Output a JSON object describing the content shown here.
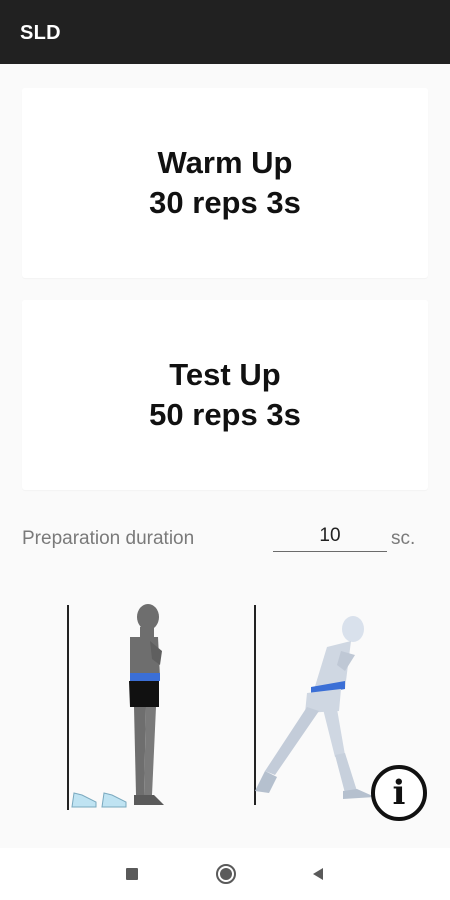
{
  "app_bar": {
    "title": "SLD"
  },
  "cards": [
    {
      "line1": "Warm Up",
      "line2": "30 reps 3s"
    },
    {
      "line1": "Test Up",
      "line2": "50 reps 3s"
    }
  ],
  "preparation": {
    "label": "Preparation duration",
    "value": "10",
    "unit": "sc."
  },
  "info_button": {
    "glyph": "i",
    "icon": "info-icon"
  },
  "nav_bar": {
    "icons": [
      "recents-icon",
      "home-icon",
      "back-icon"
    ]
  },
  "colors": {
    "app_bar": "#212121",
    "background": "#fafafa",
    "card": "#ffffff",
    "belt": "#3b6fd6",
    "figure_dark": "#6e6e6e",
    "figure_light": "#cfd7e2"
  }
}
